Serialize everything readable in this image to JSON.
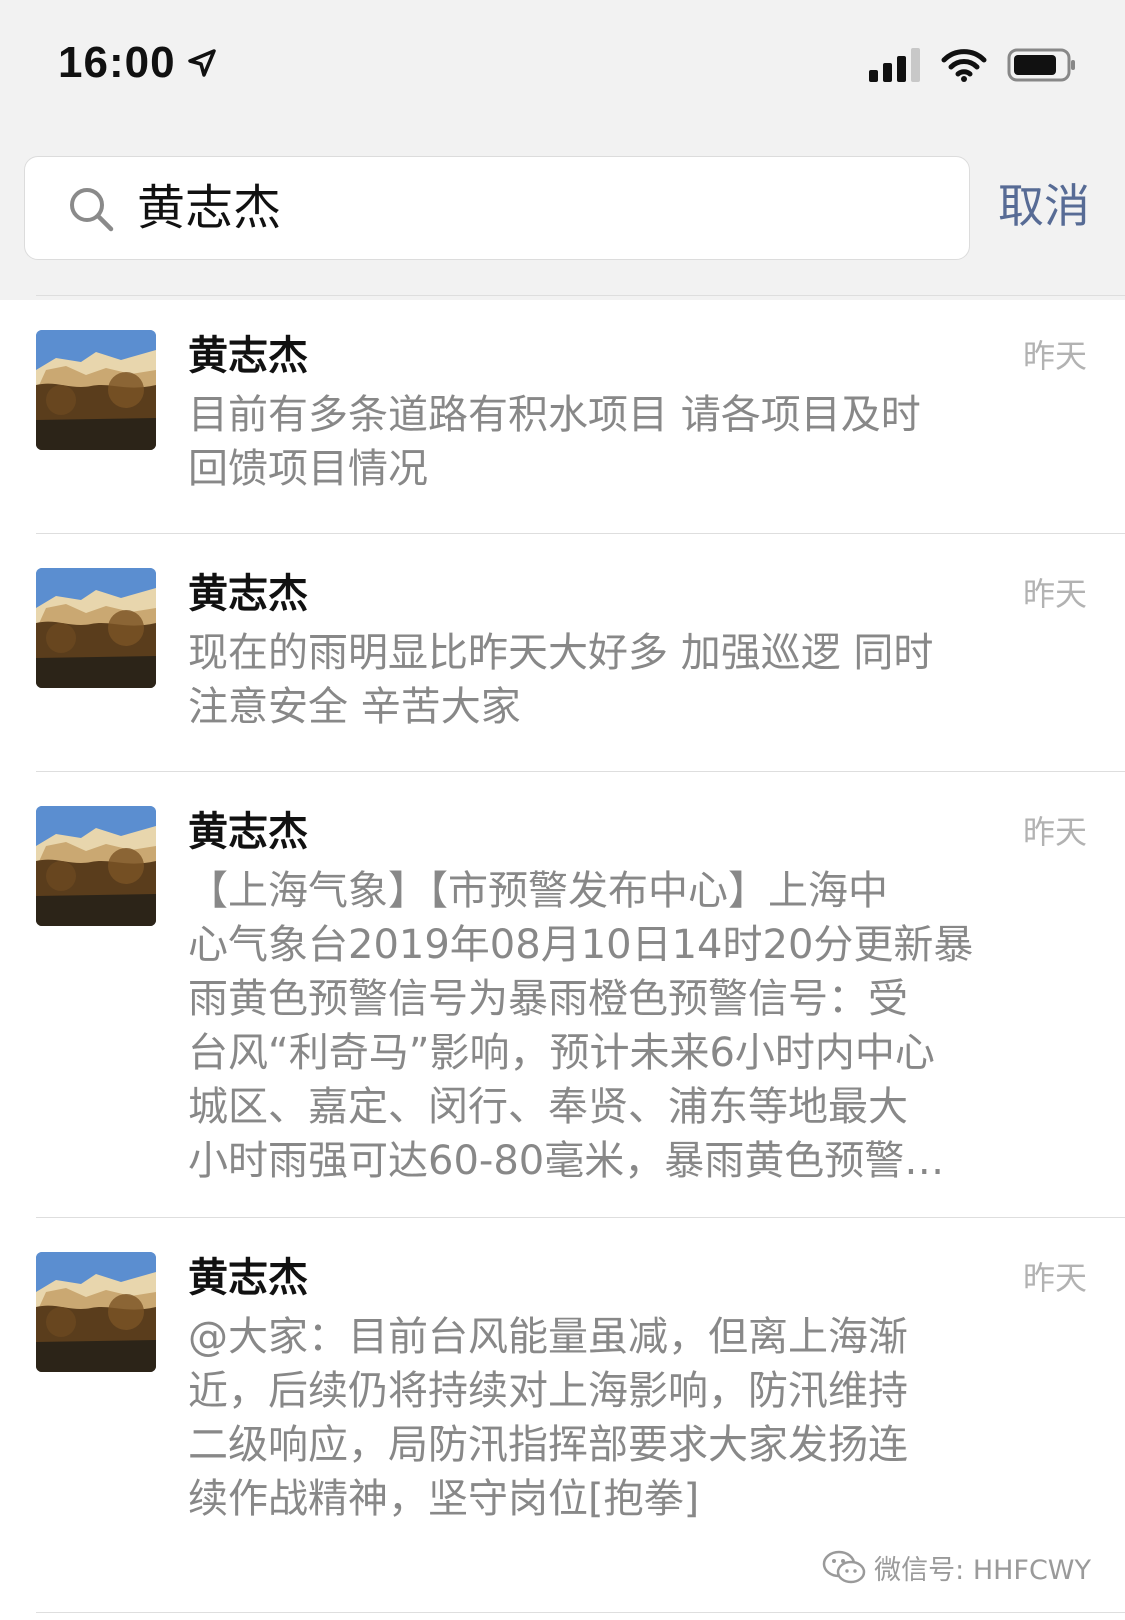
{
  "status_bar": {
    "time": "16:00"
  },
  "search": {
    "query": "黄志杰",
    "cancel_label": "取消"
  },
  "results": [
    {
      "name": "黄志杰",
      "time": "昨天",
      "message": "目前有多条道路有积水项目 请各项目及时\n回馈项目情况"
    },
    {
      "name": "黄志杰",
      "time": "昨天",
      "message": "现在的雨明显比昨天大好多 加强巡逻 同时\n注意安全 辛苦大家"
    },
    {
      "name": "黄志杰",
      "time": "昨天",
      "message": "【上海气象】【市预警发布中心】上海中\n心气象台2019年08月10日14时20分更新暴\n雨黄色预警信号为暴雨橙色预警信号：受\n台风“利奇马”影响，预计未来6小时内中心\n城区、嘉定、闵行、奉贤、浦东等地最大\n小时雨强可达60-80毫米，暴雨黄色预警…"
    },
    {
      "name": "黄志杰",
      "time": "昨天",
      "message": "@大家：目前台风能量虽减，但离上海渐\n近，后续仍将持续对上海影响，防汛维持\n二级响应，局防汛指挥部要求大家发扬连\n续作战精神，坚守岗位[抱拳]"
    }
  ],
  "watermark": {
    "text": "微信号: HHFCWY"
  },
  "colors": {
    "link": "#576b95",
    "secondary_text": "#888888",
    "header_bg": "#f2f2f2"
  }
}
